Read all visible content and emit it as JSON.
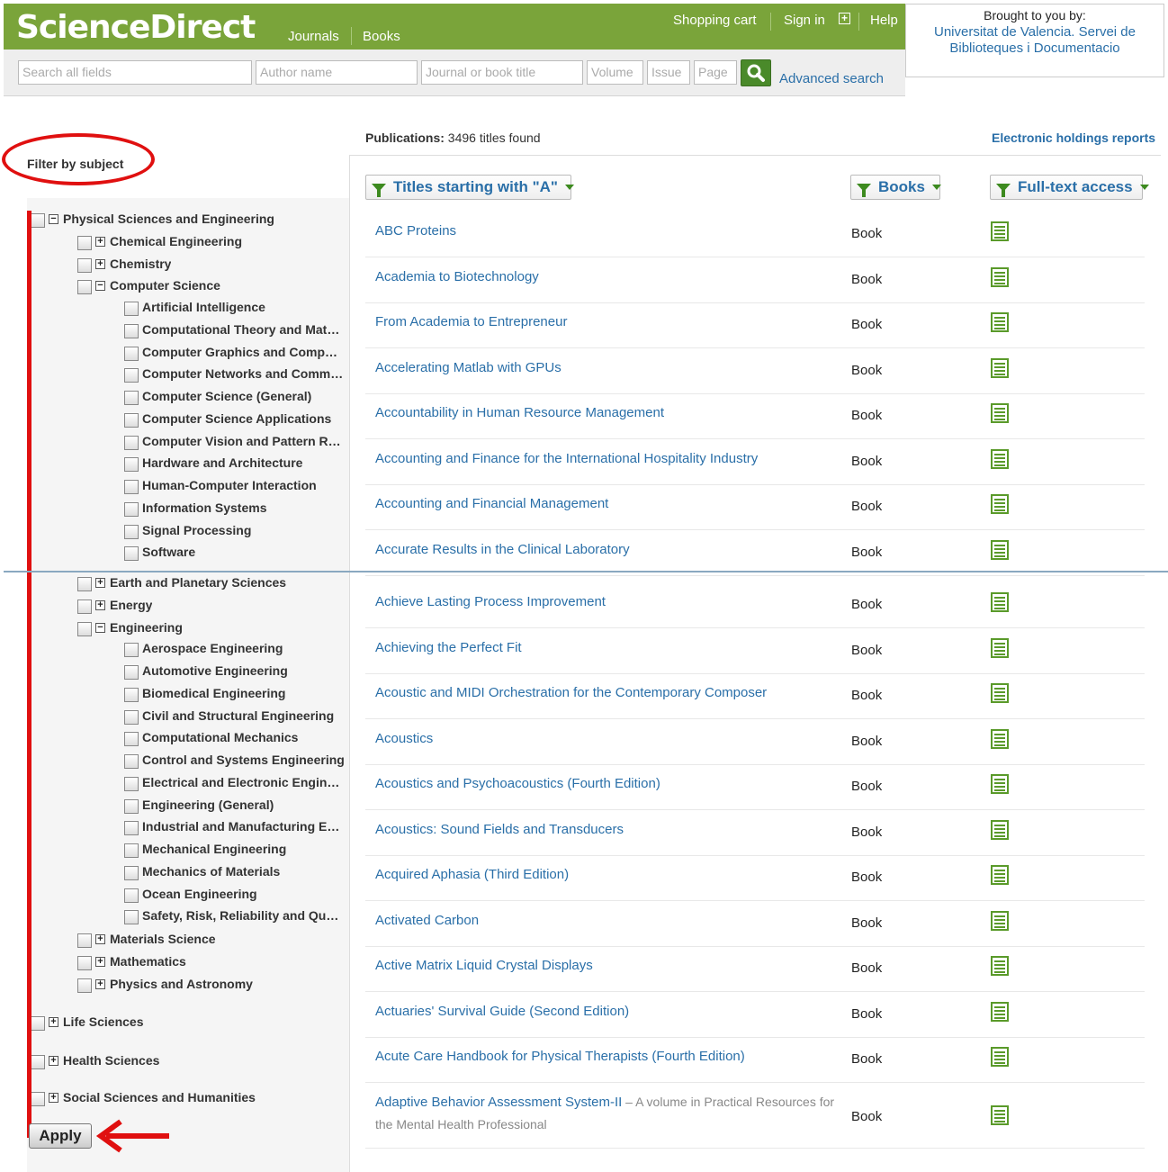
{
  "header": {
    "logo": "ScienceDirect",
    "nav": [
      "Journals",
      "Books"
    ],
    "top_links": {
      "cart": "Shopping cart",
      "signin": "Sign in",
      "help": "Help"
    },
    "brought_by_label": "Brought to you by:",
    "institution": "Universitat de Valencia. Servei de Biblioteques i Documentacio"
  },
  "search": {
    "all_fields": "Search all fields",
    "author": "Author name",
    "journal": "Journal or book title",
    "volume": "Volume",
    "issue": "Issue",
    "page": "Page",
    "advanced": "Advanced search"
  },
  "filter": {
    "title": "Filter by subject",
    "apply": "Apply",
    "items": [
      {
        "label": "Physical Sciences and Engineering",
        "expander": "−"
      },
      {
        "label": "Chemical Engineering",
        "expander": "+"
      },
      {
        "label": "Chemistry",
        "expander": "+"
      },
      {
        "label": "Computer Science",
        "expander": "−"
      },
      {
        "label": "Artificial Intelligence"
      },
      {
        "label": "Computational Theory and Mathematics"
      },
      {
        "label": "Computer Graphics and Computer-Aided Design"
      },
      {
        "label": "Computer Networks and Communications"
      },
      {
        "label": "Computer Science (General)"
      },
      {
        "label": "Computer Science Applications"
      },
      {
        "label": "Computer Vision and Pattern Recognition"
      },
      {
        "label": "Hardware and Architecture"
      },
      {
        "label": "Human-Computer Interaction"
      },
      {
        "label": "Information Systems"
      },
      {
        "label": "Signal Processing"
      },
      {
        "label": "Software"
      },
      {
        "label": "Earth and Planetary Sciences",
        "expander": "+"
      },
      {
        "label": "Energy",
        "expander": "+"
      },
      {
        "label": "Engineering",
        "expander": "−"
      },
      {
        "label": "Aerospace Engineering"
      },
      {
        "label": "Automotive Engineering"
      },
      {
        "label": "Biomedical Engineering"
      },
      {
        "label": "Civil and Structural Engineering"
      },
      {
        "label": "Computational Mechanics"
      },
      {
        "label": "Control and Systems Engineering"
      },
      {
        "label": "Electrical and Electronic Engineering"
      },
      {
        "label": "Engineering (General)"
      },
      {
        "label": "Industrial and Manufacturing Engineering"
      },
      {
        "label": "Mechanical Engineering"
      },
      {
        "label": "Mechanics of Materials"
      },
      {
        "label": "Ocean Engineering"
      },
      {
        "label": "Safety, Risk, Reliability and Quality"
      },
      {
        "label": "Materials Science",
        "expander": "+"
      },
      {
        "label": "Mathematics",
        "expander": "+"
      },
      {
        "label": "Physics and Astronomy",
        "expander": "+"
      },
      {
        "label": "Life Sciences",
        "expander": "+"
      },
      {
        "label": "Health Sciences",
        "expander": "+"
      },
      {
        "label": "Social Sciences and Humanities",
        "expander": "+"
      }
    ]
  },
  "results": {
    "count_label": "Publications:",
    "count": "3496",
    "count_suffix": "titles found",
    "holdings_link": "Electronic holdings reports",
    "filter_titles": "Titles starting with \"A\"",
    "filter_type": "Books",
    "filter_access": "Full-text access",
    "rows": [
      {
        "title": "ABC Proteins",
        "type": "Book"
      },
      {
        "title": "Academia to Biotechnology",
        "type": "Book"
      },
      {
        "title": "From Academia to Entrepreneur",
        "type": "Book"
      },
      {
        "title": "Accelerating Matlab with GPUs",
        "type": "Book"
      },
      {
        "title": "Accountability in Human Resource Management",
        "type": "Book"
      },
      {
        "title": "Accounting and Finance for the International Hospitality Industry",
        "type": "Book"
      },
      {
        "title": "Accounting and Financial Management",
        "type": "Book"
      },
      {
        "title": "Accurate Results in the Clinical Laboratory",
        "type": "Book"
      },
      {
        "title": "Achieve Lasting Process Improvement",
        "type": "Book"
      },
      {
        "title": "Achieving the Perfect Fit",
        "type": "Book"
      },
      {
        "title": "Acoustic and MIDI Orchestration for the Contemporary Composer",
        "type": "Book"
      },
      {
        "title": "Acoustics",
        "type": "Book"
      },
      {
        "title": "Acoustics and Psychoacoustics (Fourth Edition)",
        "type": "Book"
      },
      {
        "title": "Acoustics: Sound Fields and Transducers",
        "type": "Book"
      },
      {
        "title": "Acquired Aphasia (Third Edition)",
        "type": "Book"
      },
      {
        "title": "Activated Carbon",
        "type": "Book"
      },
      {
        "title": "Active Matrix Liquid Crystal Displays",
        "type": "Book"
      },
      {
        "title": "Actuaries' Survival Guide (Second Edition)",
        "type": "Book"
      },
      {
        "title": "Acute Care Handbook for Physical Therapists (Fourth Edition)",
        "type": "Book"
      },
      {
        "title": "Adaptive Behavior Assessment System-II",
        "subtitle": " – A volume in Practical Resources for the Mental Health Professional",
        "type": "Book"
      }
    ]
  },
  "colors": {
    "brand_green": "#7aa43a",
    "link_blue": "#2a6fa8",
    "annotation_red": "#e01010"
  }
}
